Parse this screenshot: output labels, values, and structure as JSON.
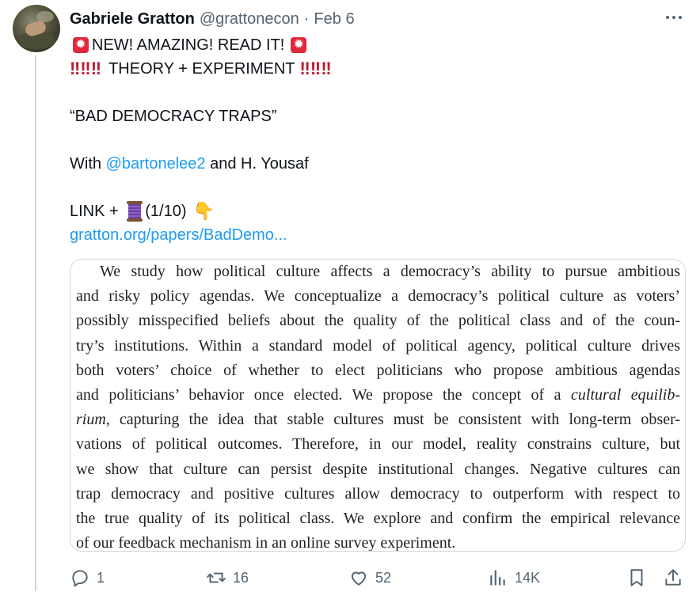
{
  "tweet": {
    "author_name": "Gabriele Gratton",
    "handle": "@grattonecon",
    "separator": "·",
    "date": "Feb 6",
    "lines": {
      "l1": "NEW! AMAZING! READ IT!",
      "l2_bangs_left": "‼️‼️‼️",
      "l2": "THEORY + EXPERIMENT",
      "l2_bangs_right": "‼️‼️‼️",
      "l3": "“BAD DEMOCRACY TRAPS”",
      "l4_prefix": "With ",
      "l4_mention": "@bartonelee2",
      "l4_suffix": " and H. Yousaf",
      "l5_prefix": "LINK + ",
      "l5_suffix": "(1/10)",
      "link": "gratton.org/papers/BadDemo..."
    }
  },
  "abstract": {
    "lines": [
      "We study how political culture affects a democracy’s ability to pursue ambitious",
      "and risky policy agendas. We conceptualize a democracy’s political culture as voters’",
      "possibly misspecified beliefs about the quality of the political class and of the coun-",
      "try’s institutions. Within a standard model of political agency, political culture drives",
      "both voters’ choice of whether to elect politicians who propose ambitious agendas",
      "and politicians’ behavior once elected.  We propose the concept of a",
      "cultural equilib-",
      "rium",
      ", capturing the idea that stable cultures must be consistent with long-term obser-",
      "vations of political outcomes. Therefore, in our model, reality constrains culture, but",
      "we show that culture can persist despite institutional changes. Negative cultures can",
      "trap democracy and positive cultures allow democracy to outperform with respect to",
      "the true quality of its political class. We explore and confirm the empirical relevance",
      "of our feedback mechanism in an online survey experiment."
    ]
  },
  "actions": {
    "replies": "1",
    "retweets": "16",
    "likes": "52",
    "views": "14K"
  },
  "colors": {
    "accent": "#1d9bf0",
    "muted": "#536471",
    "text": "#0f1419",
    "border": "#cfd9de"
  },
  "icons": [
    "siren-icon",
    "double-exclamation-icon",
    "spool-of-thread-icon",
    "point-down-icon",
    "reply-icon",
    "retweet-icon",
    "like-icon",
    "views-icon",
    "bookmark-icon",
    "share-icon",
    "more-icon"
  ]
}
